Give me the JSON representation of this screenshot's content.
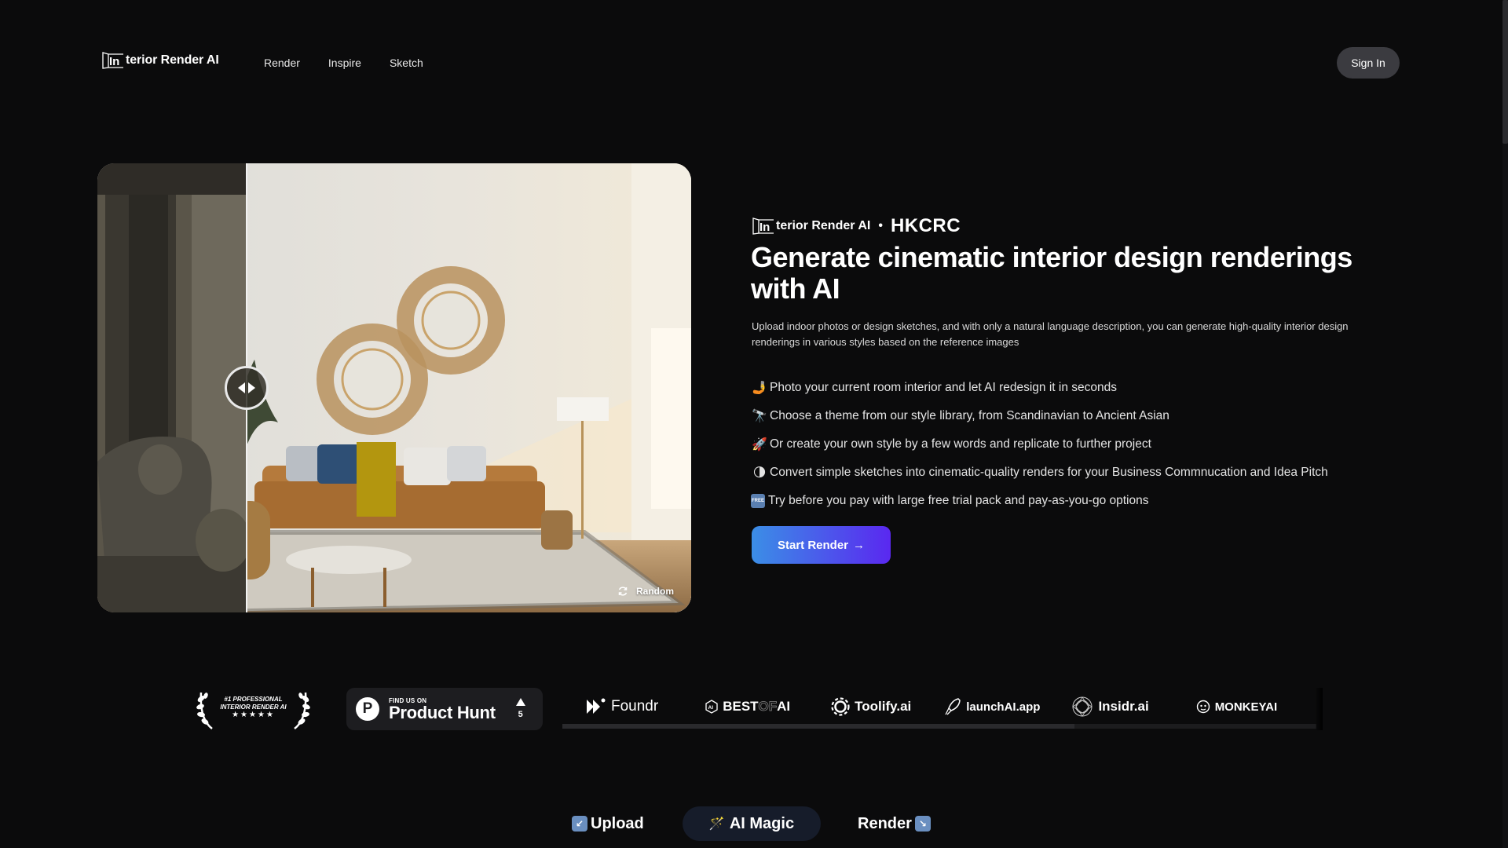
{
  "header": {
    "logo_text": "terior Render AI",
    "logo_mark": "In",
    "nav": [
      "Render",
      "Inspire",
      "Sketch"
    ],
    "sign_in": "Sign In"
  },
  "hero": {
    "compare": {
      "handle_icon": "left-right-arrows-icon",
      "random_label": "Random",
      "random_icon": "refresh-icon"
    },
    "brandline": {
      "logo_mark": "In",
      "logo_text": "terior Render AI",
      "separator": "•",
      "partner": "HKCRC"
    },
    "headline": "Generate cinematic interior design renderings with AI",
    "subtitle": "Upload indoor photos or design sketches, and with only a natural language description, you can generate high-quality interior design renderings in various styles based on the reference images",
    "features": [
      {
        "icon": "selfie-stick-icon",
        "emoji": "🤳",
        "text": "Photo your current room interior and let AI redesign it in seconds"
      },
      {
        "icon": "telescope-icon",
        "emoji": "🔭",
        "text": "Choose a theme from our style library, from Scandinavian to Ancient Asian"
      },
      {
        "icon": "rocket-icon",
        "emoji": "🚀",
        "text": "Or create your own style by a few words and replicate to further project"
      },
      {
        "icon": "moon-icon",
        "emoji": "🌗",
        "text": "Convert simple sketches into cinematic-quality renders for your Business Commnucation and Idea Pitch"
      },
      {
        "icon": "free-icon",
        "emoji": "FREE",
        "text": "Try before you pay with large free trial pack and pay-as-you-go options"
      }
    ],
    "cta": "Start Render",
    "cta_arrow": "→"
  },
  "badges": {
    "award": {
      "line1": "#1 PROFESSIONAL",
      "line2": "INTERIOR RENDER AI",
      "stars": "★★★★★"
    },
    "product_hunt": {
      "small": "FIND US ON",
      "big": "Product Hunt",
      "logo": "P",
      "votes": "5"
    },
    "partners": [
      "Foundr",
      "BEST",
      "OF",
      "AI",
      "Toolify.ai",
      "launchAI.app",
      "Insidr.ai",
      "MONKEYAI"
    ]
  },
  "steps": [
    {
      "label": "Upload",
      "icon": "↙"
    },
    {
      "label": "AI Magic",
      "icon": "🪄"
    },
    {
      "label": "Render",
      "icon": "↘"
    }
  ],
  "colors": {
    "background": "#0b0b0c",
    "cta_start": "#3b8ee6",
    "cta_end": "#5a28f0",
    "signin_bg": "#3b3b40",
    "step_active_bg": "#161c2a"
  }
}
